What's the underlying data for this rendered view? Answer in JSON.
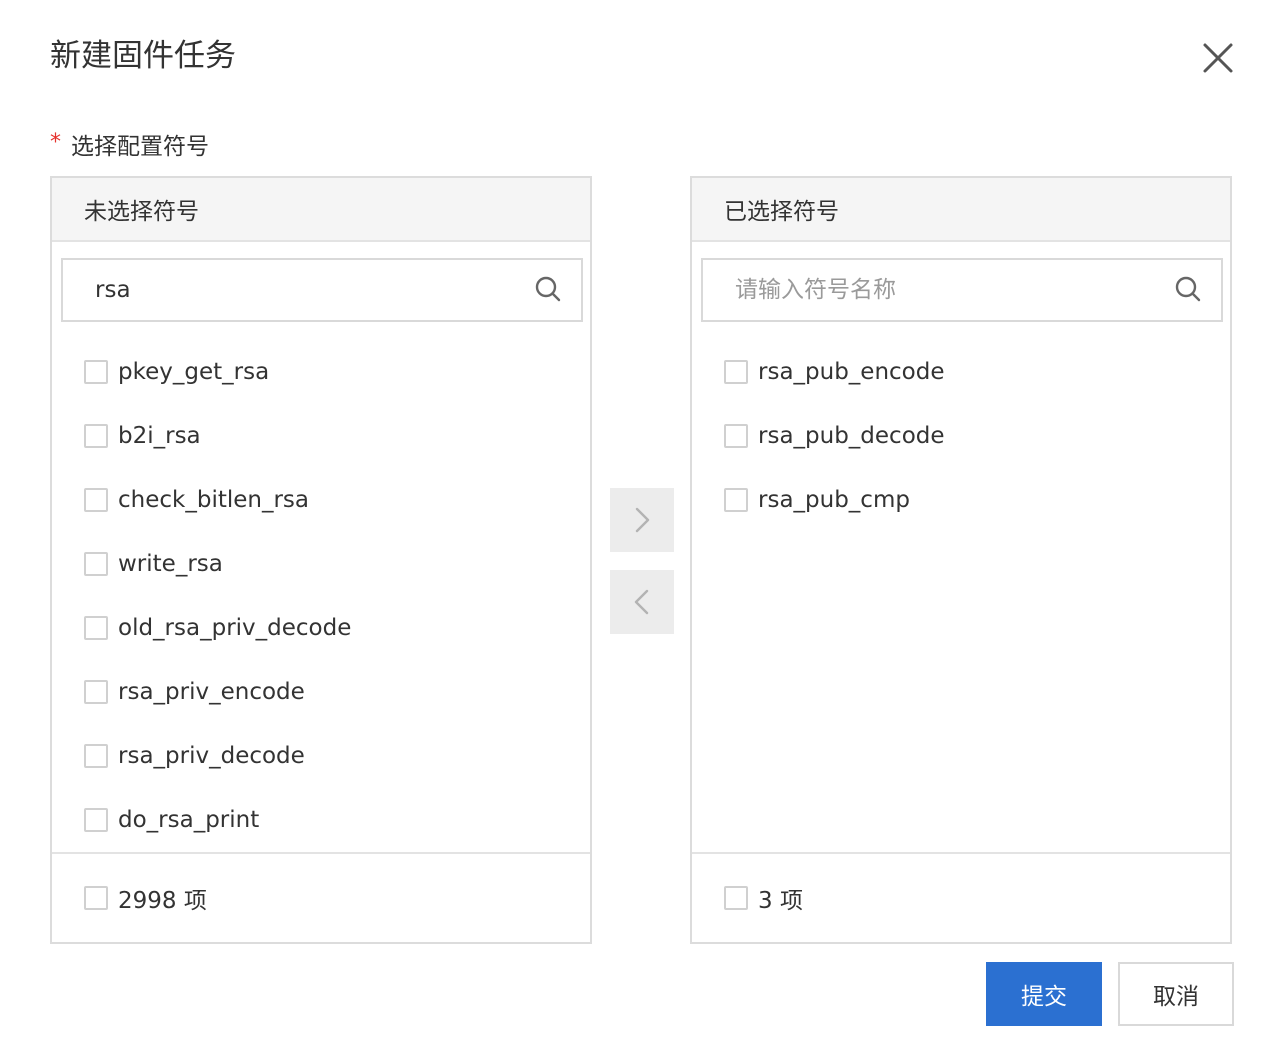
{
  "dialog": {
    "title": "新建固件任务",
    "close_icon": "close-icon"
  },
  "field": {
    "required_mark": "*",
    "label": "选择配置符号"
  },
  "left_panel": {
    "header": "未选择符号",
    "search_value": "rsa",
    "search_placeholder": "请输入符号名称",
    "items": [
      {
        "label": "pkey_get_rsa",
        "checked": false
      },
      {
        "label": "b2i_rsa",
        "checked": false
      },
      {
        "label": "check_bitlen_rsa",
        "checked": false
      },
      {
        "label": "write_rsa",
        "checked": false
      },
      {
        "label": "old_rsa_priv_decode",
        "checked": false
      },
      {
        "label": "rsa_priv_encode",
        "checked": false
      },
      {
        "label": "rsa_priv_decode",
        "checked": false
      },
      {
        "label": "do_rsa_print",
        "checked": false
      }
    ],
    "footer_count": "2998 项"
  },
  "right_panel": {
    "header": "已选择符号",
    "search_value": "",
    "search_placeholder": "请输入符号名称",
    "items": [
      {
        "label": "rsa_pub_encode",
        "checked": false
      },
      {
        "label": "rsa_pub_decode",
        "checked": false
      },
      {
        "label": "rsa_pub_cmp",
        "checked": false
      }
    ],
    "footer_count": "3 项"
  },
  "transfer": {
    "to_right_icon": "chevron-right-icon",
    "to_left_icon": "chevron-left-icon"
  },
  "actions": {
    "submit_label": "提交",
    "cancel_label": "取消"
  },
  "colors": {
    "primary": "#2b70d1",
    "required": "#e5322d",
    "header_bg": "#f5f5f5",
    "border": "#dcdcdc"
  }
}
